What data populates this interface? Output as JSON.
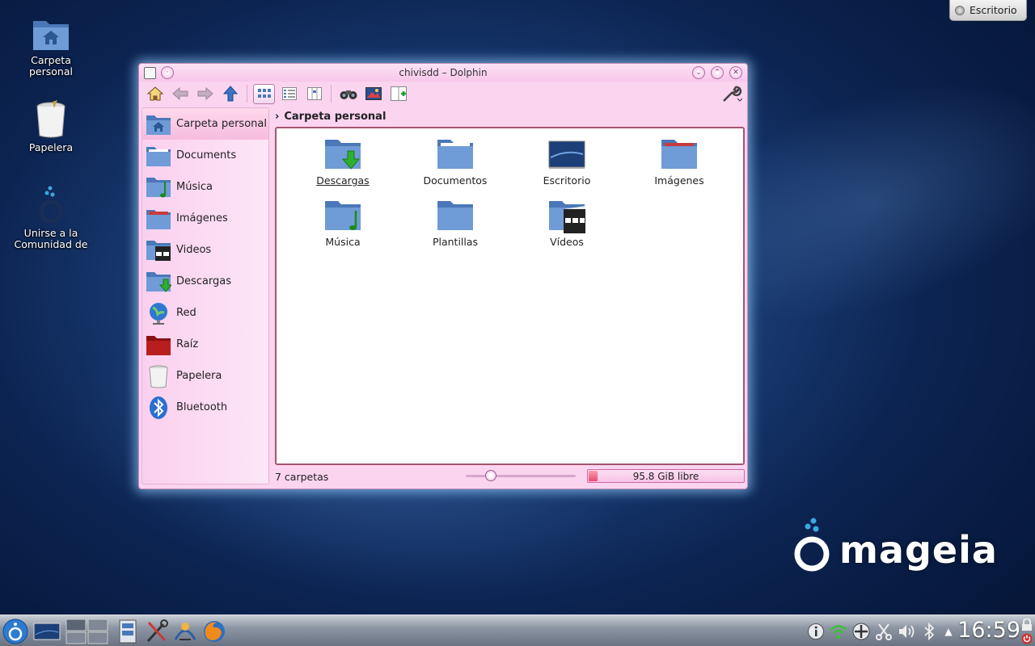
{
  "desktop": {
    "icons": [
      {
        "label": "Carpeta\npersonal",
        "icon": "home-folder-icon"
      },
      {
        "label": "Papelera",
        "icon": "trash-icon"
      },
      {
        "label": "Unirse a la\nComunidad de",
        "icon": "mageia-community-icon"
      }
    ],
    "button_label": "Escritorio"
  },
  "window": {
    "title": "chivisdd – Dolphin",
    "breadcrumb": "Carpeta personal",
    "places": [
      {
        "label": "Carpeta personal",
        "icon": "home-folder-icon",
        "selected": true
      },
      {
        "label": "Documents",
        "icon": "folder-icon"
      },
      {
        "label": "Música",
        "icon": "music-folder-icon"
      },
      {
        "label": "Imágenes",
        "icon": "pictures-folder-icon"
      },
      {
        "label": "Videos",
        "icon": "videos-folder-icon"
      },
      {
        "label": "Descargas",
        "icon": "downloads-folder-icon"
      },
      {
        "label": "Red",
        "icon": "network-globe-icon"
      },
      {
        "label": "Raíz",
        "icon": "root-folder-icon"
      },
      {
        "label": "Papelera",
        "icon": "trash-icon"
      },
      {
        "label": "Bluetooth",
        "icon": "bluetooth-icon"
      }
    ],
    "items": [
      {
        "label": "Descargas",
        "icon": "downloads-folder-icon"
      },
      {
        "label": "Documentos",
        "icon": "documents-folder-icon"
      },
      {
        "label": "Escritorio",
        "icon": "desktop-folder-icon"
      },
      {
        "label": "Imágenes",
        "icon": "pictures-folder-icon"
      },
      {
        "label": "Música",
        "icon": "music-folder-icon"
      },
      {
        "label": "Plantillas",
        "icon": "templates-folder-icon"
      },
      {
        "label": "Vídeos",
        "icon": "videos-folder-icon"
      }
    ],
    "status_text": "7 carpetas",
    "free_space": "95.8 GiB libre",
    "disk_used_fraction": 0.06,
    "zoom_fraction": 0.2
  },
  "brand": {
    "logo_text": "mageia"
  },
  "taskbar": {
    "clock": "16:59"
  },
  "colors": {
    "window_bg": "#fbd4f0",
    "view_border": "#a3566f",
    "folder_blue": "#5b87c3"
  }
}
